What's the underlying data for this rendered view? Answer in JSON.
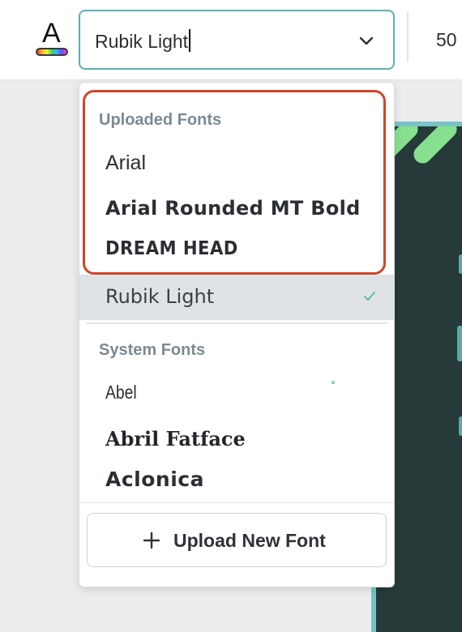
{
  "toolbar": {
    "text_color_letter": "A",
    "font_field_value": "Rubik Light",
    "font_size_value": "50"
  },
  "dropdown": {
    "uploaded_header": "Uploaded Fonts",
    "uploaded_fonts": [
      "Arial",
      "Arial Rounded MT Bold",
      "DREAM HEAD"
    ],
    "current_font": "Rubik Light",
    "system_header": "System Fonts",
    "system_fonts": [
      "Abel",
      "Abril Fatface",
      "Aclonica"
    ],
    "upload_button_label": "Upload New Font"
  },
  "colors": {
    "accent_border": "#5ab0b4",
    "highlight_red": "#d0452c",
    "selected_row": "#dfe3e5",
    "canvas_bg": "#263a3a",
    "canvas_stripe": "#86e08f"
  },
  "icons": {
    "dropdown_toggle": "chevron-down-icon",
    "selected_marker": "check-icon",
    "upload": "plus-icon",
    "text_color": "text-color-icon"
  }
}
